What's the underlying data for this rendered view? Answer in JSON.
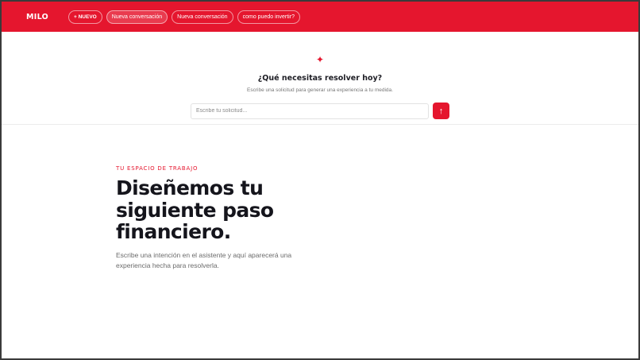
{
  "brand": {
    "name": "MILO",
    "accent": "#e5162e"
  },
  "topbar": {
    "new_label": "+ NUEVO",
    "tabs": [
      {
        "label": "Nueva conversación"
      },
      {
        "label": "Nueva conversación"
      },
      {
        "label": "como puedo invertir?"
      }
    ]
  },
  "prompt": {
    "icon": "sparkle-icon",
    "title": "¿Qué necesitas resolver hoy?",
    "subtitle": "Escribe una solicitud para generar una experiencia a tu medida.",
    "input_placeholder": "Escribe tu solicitud...",
    "input_value": "",
    "send_icon": "arrow-up-icon"
  },
  "hero": {
    "eyebrow": "TU ESPACIO DE TRABAJO",
    "headline": "Diseñemos tu siguiente paso financiero.",
    "description": "Escribe una intención en el asistente y aquí aparecerá una experiencia hecha para resolverla."
  }
}
